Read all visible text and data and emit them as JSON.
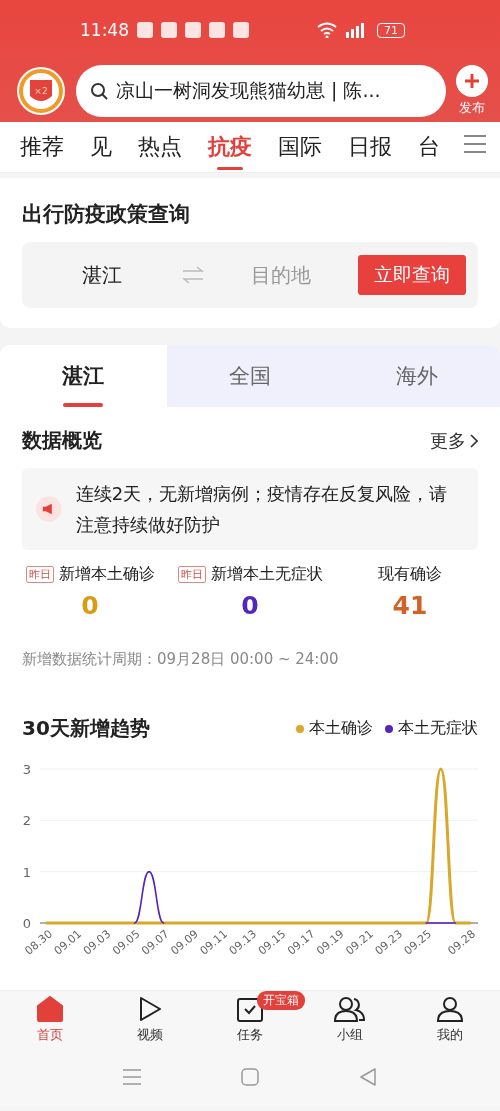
{
  "status_bar": {
    "time": "11:48",
    "battery": "71"
  },
  "header": {
    "badge": "×2",
    "search_text": "凉山一树洞发现熊猫幼崽 | 陈...",
    "publish_label": "发布"
  },
  "channel_tabs": [
    {
      "label": "推荐",
      "selected": false
    },
    {
      "label": "见",
      "selected": false
    },
    {
      "label": "热点",
      "selected": false
    },
    {
      "label": "抗疫",
      "selected": true
    },
    {
      "label": "国际",
      "selected": false
    },
    {
      "label": "日报",
      "selected": false
    },
    {
      "label": "台",
      "selected": false
    }
  ],
  "policy": {
    "title": "出行防疫政策查询",
    "from": "湛江",
    "to_placeholder": "目的地",
    "button": "立即查询"
  },
  "region_tabs": [
    {
      "label": "湛江",
      "selected": true
    },
    {
      "label": "全国",
      "selected": false
    },
    {
      "label": "海外",
      "selected": false
    }
  ],
  "overview": {
    "title": "数据概览",
    "more": "更多",
    "notice": "连续2天，无新增病例；疫情存在反复风险，请注意持续做好防护",
    "stats": [
      {
        "tag": "昨日",
        "label": "新增本土确诊",
        "value": "0",
        "color": "#d99a16"
      },
      {
        "tag": "昨日",
        "label": "新增本土无症状",
        "value": "0",
        "color": "#5527b8"
      },
      {
        "label": "现有确诊",
        "value": "41",
        "color": "#d0622a"
      }
    ],
    "period": "新增数据统计周期：09月28日 00:00 ~ 24:00"
  },
  "trend": {
    "title": "30天新增趋势",
    "chart_data": {
      "type": "line",
      "categories": [
        "08.30",
        null,
        "09.01",
        null,
        "09.03",
        null,
        "09.05",
        null,
        "09.07",
        null,
        "09.09",
        null,
        "09.11",
        null,
        "09.13",
        null,
        "09.15",
        null,
        "09.17",
        null,
        "09.19",
        null,
        "09.21",
        null,
        "09.23",
        null,
        "09.25",
        null,
        null,
        "09.28"
      ],
      "series": [
        {
          "name": "本土确诊",
          "color": "#d9a72a",
          "values": [
            0,
            0,
            0,
            0,
            0,
            0,
            0,
            0,
            0,
            0,
            0,
            0,
            0,
            0,
            0,
            0,
            0,
            0,
            0,
            0,
            0,
            0,
            0,
            0,
            0,
            0,
            0,
            3,
            0,
            0
          ]
        },
        {
          "name": "本土无症状",
          "color": "#5527b8",
          "values": [
            null,
            null,
            null,
            null,
            null,
            null,
            0,
            1,
            0,
            null,
            null,
            null,
            null,
            null,
            null,
            null,
            null,
            null,
            null,
            null,
            null,
            null,
            null,
            null,
            null,
            null,
            0,
            0,
            0,
            null
          ]
        }
      ],
      "ylim": [
        0,
        3
      ],
      "yticks": [
        0,
        1,
        2,
        3
      ]
    }
  },
  "bottom_nav": [
    {
      "kind": "home",
      "label": "首页",
      "selected": true
    },
    {
      "kind": "video",
      "label": "视频",
      "selected": false
    },
    {
      "kind": "task",
      "label": "任务",
      "selected": false,
      "badge": "开宝箱"
    },
    {
      "kind": "group",
      "label": "小组",
      "selected": false
    },
    {
      "kind": "me",
      "label": "我的",
      "selected": false
    }
  ]
}
